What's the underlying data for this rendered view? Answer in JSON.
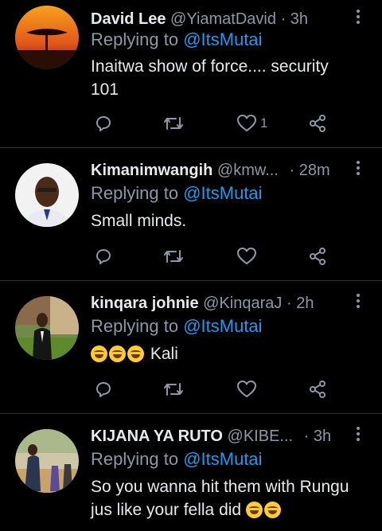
{
  "tweets": [
    {
      "name": "David Lee",
      "handle": "@YiamatDavid",
      "separator": "·",
      "time": "3h",
      "replying_prefix": "Replying to",
      "replying_to": "@ItsMutai",
      "text_lines": [
        "Inaitwa show of force.... security",
        "101"
      ],
      "like_count": "1"
    },
    {
      "name": "Kimanimwangih",
      "handle": "@kmw...",
      "separator": "·",
      "time": "28m",
      "replying_prefix": "Replying to",
      "replying_to": "@ItsMutai",
      "text_lines": [
        "Small minds."
      ],
      "like_count": ""
    },
    {
      "name": "kinqara johnie",
      "handle": "@KinqaraJ",
      "separator": "·",
      "time": "2h",
      "replying_prefix": "Replying to",
      "replying_to": "@ItsMutai",
      "text_lines": [
        "Kali"
      ],
      "like_count": ""
    },
    {
      "name": "KIJANA YA RUTO",
      "handle": "@KIBE...",
      "separator": "·",
      "time": "3h",
      "replying_prefix": "Replying to",
      "replying_to": "@ItsMutai",
      "text_lines": [
        "So you wanna hit them with Rungu",
        "jus like your fella did"
      ],
      "like_count": ""
    }
  ],
  "icons": [
    "reply-icon",
    "retweet-icon",
    "like-icon",
    "share-icon",
    "more-options-icon"
  ],
  "colors": {
    "background": "#000000",
    "text": "#e7e9ea",
    "muted": "#8b98a5",
    "mention": "#1d9bf0",
    "divider": "#2f3336"
  }
}
